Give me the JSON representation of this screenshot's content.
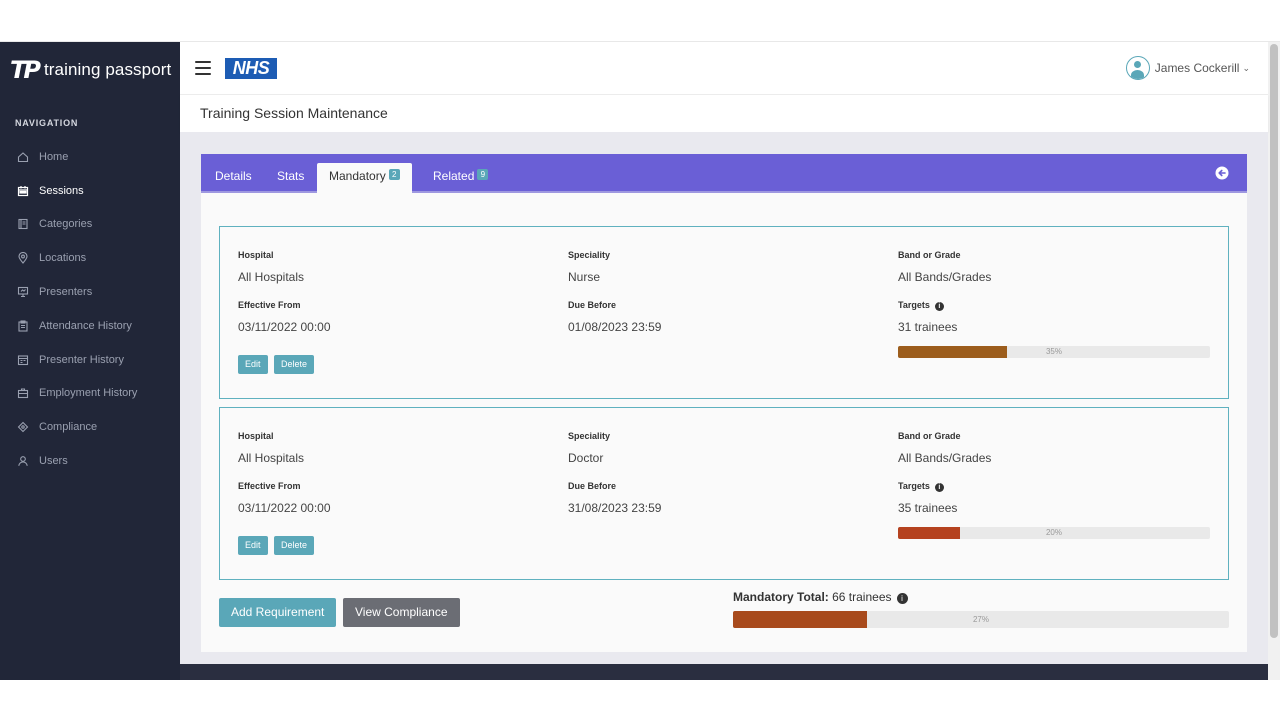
{
  "brand": {
    "mark": "TP",
    "name": "training passport"
  },
  "header": {
    "logo": "NHS",
    "user_name": "James Cockerill",
    "caret": "⌄"
  },
  "sidebar": {
    "heading": "NAVIGATION",
    "items": [
      {
        "label": "Home",
        "icon": "home-icon"
      },
      {
        "label": "Sessions",
        "icon": "calendar-icon",
        "active": true
      },
      {
        "label": "Categories",
        "icon": "book-icon"
      },
      {
        "label": "Locations",
        "icon": "map-pin-icon"
      },
      {
        "label": "Presenters",
        "icon": "presentation-icon"
      },
      {
        "label": "Attendance History",
        "icon": "clipboard-icon"
      },
      {
        "label": "Presenter History",
        "icon": "history-icon"
      },
      {
        "label": "Employment History",
        "icon": "briefcase-icon"
      },
      {
        "label": "Compliance",
        "icon": "compass-icon"
      },
      {
        "label": "Users",
        "icon": "user-icon"
      }
    ]
  },
  "page": {
    "title": "Training Session Maintenance"
  },
  "tabs": [
    {
      "label": "Details"
    },
    {
      "label": "Stats"
    },
    {
      "label": "Mandatory",
      "badge": "2",
      "active": true
    },
    {
      "label": "Related",
      "badge": "9"
    }
  ],
  "requirements": [
    {
      "hospital_label": "Hospital",
      "hospital": "All Hospitals",
      "speciality_label": "Speciality",
      "speciality": "Nurse",
      "band_label": "Band or Grade",
      "band": "All Bands/Grades",
      "effective_label": "Effective From",
      "effective": "03/11/2022 00:00",
      "due_label": "Due Before",
      "due": "01/08/2023 23:59",
      "targets_label": "Targets",
      "targets": "31 trainees",
      "progress": 35,
      "progress_text": "35%",
      "progress_color": "#9c5d1c",
      "edit_label": "Edit",
      "delete_label": "Delete"
    },
    {
      "hospital_label": "Hospital",
      "hospital": "All Hospitals",
      "speciality_label": "Speciality",
      "speciality": "Doctor",
      "band_label": "Band or Grade",
      "band": "All Bands/Grades",
      "effective_label": "Effective From",
      "effective": "03/11/2022 00:00",
      "due_label": "Due Before",
      "due": "31/08/2023 23:59",
      "targets_label": "Targets",
      "targets": "35 trainees",
      "progress": 20,
      "progress_text": "20%",
      "progress_color": "#b5421f",
      "edit_label": "Edit",
      "delete_label": "Delete"
    }
  ],
  "actions": {
    "add_label": "Add Requirement",
    "view_label": "View Compliance"
  },
  "total": {
    "label": "Mandatory Total:",
    "value": "66 trainees",
    "progress": 27,
    "progress_text": "27%",
    "progress_color": "#a84a1c"
  },
  "colors": {
    "sidebar": "#212638",
    "tabbar": "#6a5fd6",
    "teal": "#5aa7b8",
    "grey_button": "#6b6d74"
  }
}
